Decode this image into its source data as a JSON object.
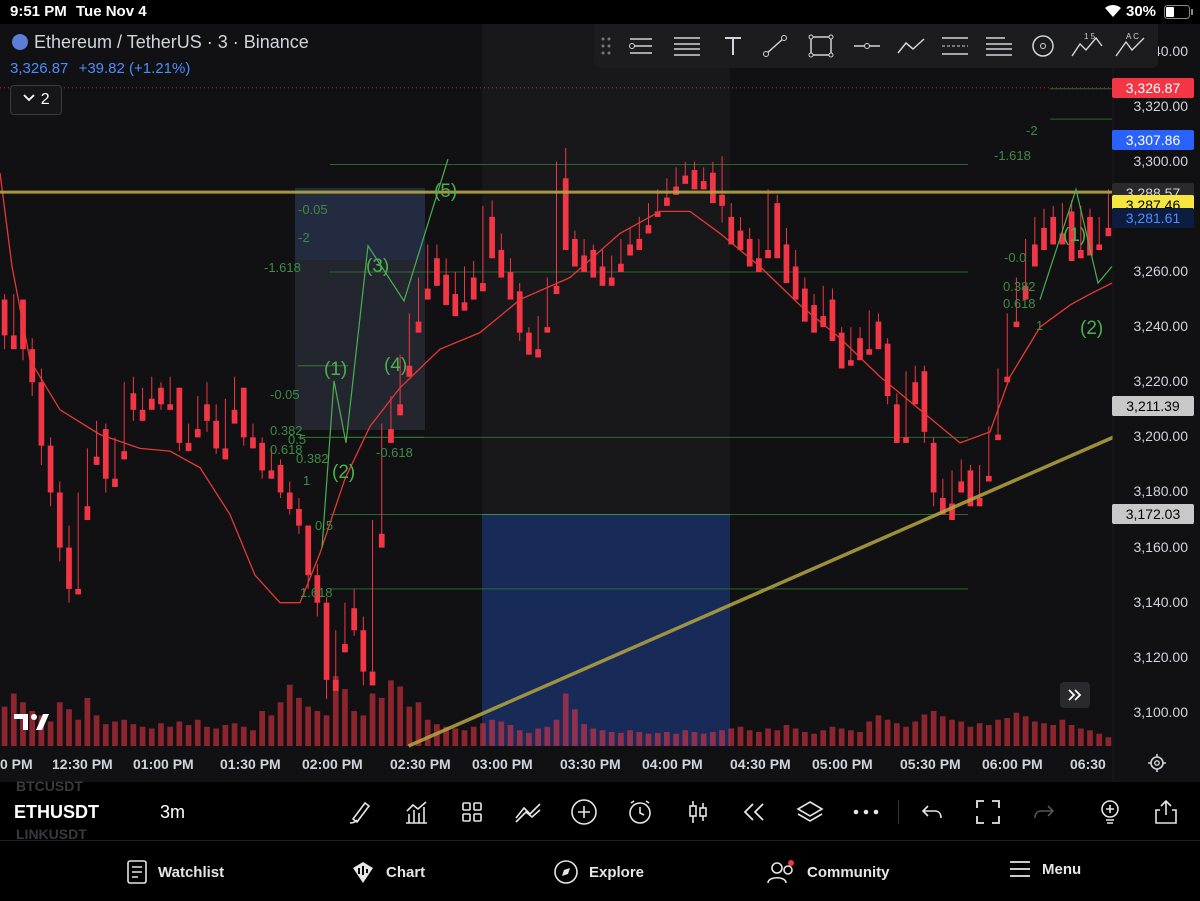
{
  "status_bar": {
    "time": "9:51 PM",
    "date": "Tue Nov 4",
    "battery": "30%"
  },
  "symbol": {
    "title": "Ethereum / TetherUS · 3 · Binance",
    "price": "3,326.87",
    "change": "+39.82 (+1.21%)",
    "indicators_count": "2"
  },
  "price_axis": {
    "ticks": [
      "3,340.00",
      "3,320.00",
      "3,300.00",
      "3,260.00",
      "3,240.00",
      "3,220.00",
      "3,200.00",
      "3,180.00",
      "3,160.00",
      "3,140.00",
      "3,120.00",
      "3,100.00"
    ],
    "tick_values": [
      3340,
      3320,
      3300,
      3260,
      3240,
      3220,
      3200,
      3180,
      3160,
      3140,
      3120,
      3100
    ],
    "flags": [
      {
        "label": "3,326.87",
        "value": 3326.87,
        "bg": "#f23645",
        "fg": "#ffffff"
      },
      {
        "label": "3,307.86",
        "value": 3307.86,
        "bg": "#2962ff",
        "fg": "#ffffff"
      },
      {
        "label": "3,288.57",
        "value": 3288.57,
        "bg": "#2a2a2a",
        "fg": "#d1d4dc"
      },
      {
        "label": "3,287.46",
        "value": 3284.3,
        "bg": "#f5e642",
        "fg": "#000000"
      },
      {
        "label": "3,281.61",
        "value": 3279.5,
        "bg": "#0d1d3f",
        "fg": "#4c8dff"
      },
      {
        "label": "3,211.39",
        "value": 3211.39,
        "bg": "#c8c8c8",
        "fg": "#000000"
      },
      {
        "label": "3,172.03",
        "value": 3172.03,
        "bg": "#c8c8c8",
        "fg": "#000000"
      }
    ]
  },
  "time_axis": {
    "ticks": [
      "0 PM",
      "12:30 PM",
      "01:00 PM",
      "01:30 PM",
      "02:00 PM",
      "02:30 PM",
      "03:00 PM",
      "03:30 PM",
      "04:00 PM",
      "04:30 PM",
      "05:00 PM",
      "05:30 PM",
      "06:00 PM",
      "06:30"
    ]
  },
  "wave_labels": [
    "(1)",
    "(2)",
    "(3)",
    "(4)",
    "(5)",
    "(1)",
    "(2)"
  ],
  "fib_labels": [
    "-0.05",
    "-2",
    "-1.618",
    "-0.05",
    "0.382",
    "0.5",
    "0.618",
    "0.382",
    "1",
    "0.5",
    "1.618",
    "-0.618",
    "-2",
    "-1.618",
    "-0.0",
    "0.382",
    "0.618",
    "1"
  ],
  "colors": {
    "up": "#2962ff",
    "down": "#f23645",
    "ma": "#e53935",
    "trendline": "#b5a642",
    "fib": "#2e7d32",
    "range_box": "#1a3a8a"
  },
  "drawing_tools": [
    "drag-handle-icon",
    "pitchfork-icon",
    "fib-retracement-icon",
    "text-icon",
    "trendline-icon",
    "rectangle-icon",
    "horizontal-ray-icon",
    "path-icon",
    "long-position-icon",
    "fib-extension-icon",
    "circle-icon",
    "elliott-impulse-icon",
    "elliott-correction-icon"
  ],
  "elliott_icon_labels": {
    "impulse": "1 5",
    "correction": "A C"
  },
  "bottom_toolbar": {
    "symbols": {
      "previous": "BTCUSDT",
      "current": "ETHUSDT",
      "next": "LINKUSDT"
    },
    "interval": "3m",
    "icons": [
      "draw-brush-icon",
      "indicators-icon",
      "layouts-icon",
      "compare-icon",
      "add-icon",
      "alert-icon",
      "candles-icon",
      "replay-icon",
      "layers-icon",
      "more-icon",
      "undo-icon",
      "fullscreen-icon",
      "redo-icon",
      "ideas-icon",
      "share-icon"
    ]
  },
  "nav": [
    {
      "label": "Watchlist",
      "icon": "watchlist-icon"
    },
    {
      "label": "Chart",
      "icon": "chart-icon"
    },
    {
      "label": "Explore",
      "icon": "compass-icon"
    },
    {
      "label": "Community",
      "icon": "community-icon"
    },
    {
      "label": "Menu",
      "icon": "menu-icon"
    }
  ],
  "chart_data": {
    "type": "candlestick",
    "symbol": "ETHUSDT",
    "interval": "3m",
    "ylim": [
      3088,
      3350
    ],
    "candles": [
      [
        3250,
        3252,
        3237,
        3232
      ],
      [
        3237,
        3252,
        3232,
        3250
      ],
      [
        3250,
        3245,
        3232,
        3228
      ],
      [
        3232,
        3236,
        3220,
        3215
      ],
      [
        3220,
        3225,
        3197,
        3190
      ],
      [
        3197,
        3200,
        3180,
        3175
      ],
      [
        3180,
        3184,
        3160,
        3155
      ],
      [
        3160,
        3168,
        3145,
        3140
      ],
      [
        3145,
        3180,
        3143,
        3175
      ],
      [
        3175,
        3196,
        3170,
        3193
      ],
      [
        3193,
        3206,
        3190,
        3203
      ],
      [
        3203,
        3205,
        3185,
        3180
      ],
      [
        3185,
        3200,
        3182,
        3195
      ],
      [
        3195,
        3220,
        3192,
        3216
      ],
      [
        3216,
        3222,
        3210,
        3206
      ],
      [
        3210,
        3218,
        3206,
        3214
      ],
      [
        3214,
        3222,
        3210,
        3218
      ],
      [
        3218,
        3220,
        3212,
        3210
      ],
      [
        3212,
        3222,
        3210,
        3218
      ],
      [
        3218,
        3212,
        3198,
        3195
      ],
      [
        3198,
        3205,
        3195,
        3203
      ],
      [
        3203,
        3215,
        3200,
        3212
      ],
      [
        3212,
        3220,
        3206,
        3202
      ],
      [
        3206,
        3212,
        3196,
        3194
      ],
      [
        3196,
        3214,
        3192,
        3210
      ],
      [
        3210,
        3222,
        3205,
        3218
      ],
      [
        3218,
        3212,
        3200,
        3197
      ],
      [
        3200,
        3205,
        3196,
        3198
      ],
      [
        3198,
        3200,
        3188,
        3185
      ],
      [
        3188,
        3196,
        3185,
        3190
      ],
      [
        3190,
        3192,
        3180,
        3178
      ],
      [
        3180,
        3184,
        3174,
        3172
      ],
      [
        3174,
        3178,
        3168,
        3165
      ],
      [
        3168,
        3165,
        3150,
        3145
      ],
      [
        3150,
        3154,
        3140,
        3135
      ],
      [
        3140,
        3142,
        3112,
        3105
      ],
      [
        3112,
        3130,
        3108,
        3125
      ],
      [
        3125,
        3140,
        3122,
        3138
      ],
      [
        3138,
        3145,
        3130,
        3128
      ],
      [
        3130,
        3135,
        3115,
        3110
      ],
      [
        3115,
        3170,
        3110,
        3165
      ],
      [
        3165,
        3205,
        3160,
        3203
      ],
      [
        3203,
        3215,
        3198,
        3212
      ],
      [
        3212,
        3230,
        3208,
        3226
      ],
      [
        3226,
        3245,
        3222,
        3242
      ],
      [
        3242,
        3258,
        3238,
        3254
      ],
      [
        3254,
        3270,
        3250,
        3265
      ],
      [
        3265,
        3270,
        3255,
        3259
      ],
      [
        3259,
        3265,
        3248,
        3252
      ],
      [
        3252,
        3260,
        3244,
        3249
      ],
      [
        3249,
        3262,
        3246,
        3258
      ],
      [
        3258,
        3264,
        3250,
        3256
      ],
      [
        3256,
        3284,
        3253,
        3280
      ],
      [
        3280,
        3286,
        3265,
        3268
      ],
      [
        3268,
        3274,
        3258,
        3260
      ],
      [
        3260,
        3265,
        3250,
        3253
      ],
      [
        3253,
        3256,
        3238,
        3235
      ],
      [
        3238,
        3240,
        3230,
        3232
      ],
      [
        3232,
        3244,
        3229,
        3240
      ],
      [
        3240,
        3258,
        3238,
        3255
      ],
      [
        3255,
        3300,
        3252,
        3294
      ],
      [
        3294,
        3305,
        3268,
        3272
      ],
      [
        3272,
        3275,
        3262,
        3266
      ],
      [
        3266,
        3272,
        3260,
        3268
      ],
      [
        3268,
        3270,
        3258,
        3262
      ],
      [
        3262,
        3268,
        3255,
        3258
      ],
      [
        3258,
        3266,
        3255,
        3263
      ],
      [
        3263,
        3272,
        3260,
        3270
      ],
      [
        3270,
        3276,
        3266,
        3272
      ],
      [
        3272,
        3280,
        3268,
        3277
      ],
      [
        3277,
        3285,
        3274,
        3282
      ],
      [
        3282,
        3290,
        3280,
        3287
      ],
      [
        3287,
        3294,
        3284,
        3291
      ],
      [
        3291,
        3298,
        3288,
        3295
      ],
      [
        3295,
        3300,
        3292,
        3297
      ],
      [
        3297,
        3300,
        3290,
        3293
      ],
      [
        3293,
        3298,
        3290,
        3296
      ],
      [
        3296,
        3300,
        3285,
        3288
      ],
      [
        3288,
        3302,
        3284,
        3278
      ],
      [
        3280,
        3285,
        3270,
        3275
      ],
      [
        3275,
        3280,
        3268,
        3272
      ],
      [
        3272,
        3276,
        3262,
        3265
      ],
      [
        3265,
        3272,
        3260,
        3268
      ],
      [
        3268,
        3290,
        3265,
        3285
      ],
      [
        3285,
        3288,
        3265,
        3270
      ],
      [
        3270,
        3276,
        3256,
        3262
      ],
      [
        3262,
        3268,
        3250,
        3254
      ],
      [
        3254,
        3258,
        3242,
        3248
      ],
      [
        3248,
        3252,
        3238,
        3244
      ],
      [
        3244,
        3255,
        3240,
        3250
      ],
      [
        3250,
        3254,
        3235,
        3238
      ],
      [
        3238,
        3240,
        3225,
        3228
      ],
      [
        3228,
        3240,
        3226,
        3236
      ],
      [
        3236,
        3240,
        3228,
        3232
      ],
      [
        3232,
        3246,
        3230,
        3242
      ],
      [
        3242,
        3245,
        3232,
        3234
      ],
      [
        3234,
        3236,
        3215,
        3212
      ],
      [
        3212,
        3216,
        3198,
        3200
      ],
      [
        3200,
        3224,
        3198,
        3220
      ],
      [
        3220,
        3226,
        3212,
        3224
      ],
      [
        3224,
        3226,
        3202,
        3198
      ],
      [
        3198,
        3200,
        3180,
        3175
      ],
      [
        3178,
        3185,
        3172,
        3176
      ],
      [
        3176,
        3188,
        3170,
        3184
      ],
      [
        3184,
        3192,
        3180,
        3188
      ],
      [
        3188,
        3190,
        3175,
        3178
      ],
      [
        3178,
        3190,
        3175,
        3186
      ],
      [
        3186,
        3204,
        3184,
        3201
      ],
      [
        3201,
        3225,
        3199,
        3222
      ],
      [
        3222,
        3245,
        3220,
        3242
      ],
      [
        3242,
        3258,
        3240,
        3255
      ],
      [
        3255,
        3272,
        3250,
        3270
      ],
      [
        3270,
        3280,
        3262,
        3276
      ],
      [
        3276,
        3283,
        3268,
        3280
      ],
      [
        3280,
        3284,
        3270,
        3274
      ],
      [
        3274,
        3285,
        3270,
        3282
      ],
      [
        3282,
        3286,
        3264,
        3268
      ],
      [
        3268,
        3284,
        3265,
        3280
      ],
      [
        3280,
        3283,
        3266,
        3270
      ],
      [
        3270,
        3280,
        3268,
        3276
      ],
      [
        3276,
        3290,
        3273,
        3285
      ]
    ],
    "moving_average": [
      [
        0,
        3296
      ],
      [
        12,
        3262
      ],
      [
        30,
        3228
      ],
      [
        60,
        3210
      ],
      [
        100,
        3201
      ],
      [
        140,
        3196
      ],
      [
        170,
        3195
      ],
      [
        200,
        3189
      ],
      [
        230,
        3172
      ],
      [
        255,
        3150
      ],
      [
        280,
        3140
      ],
      [
        300,
        3140
      ],
      [
        320,
        3158
      ],
      [
        345,
        3185
      ],
      [
        370,
        3204
      ],
      [
        400,
        3218
      ],
      [
        440,
        3232
      ],
      [
        480,
        3238
      ],
      [
        520,
        3250
      ],
      [
        570,
        3258
      ],
      [
        620,
        3274
      ],
      [
        660,
        3282
      ],
      [
        690,
        3282
      ],
      [
        720,
        3274
      ],
      [
        760,
        3262
      ],
      [
        800,
        3248
      ],
      [
        840,
        3236
      ],
      [
        880,
        3222
      ],
      [
        920,
        3210
      ],
      [
        960,
        3198
      ],
      [
        990,
        3202
      ],
      [
        1010,
        3222
      ],
      [
        1040,
        3240
      ],
      [
        1070,
        3248
      ],
      [
        1090,
        3252
      ],
      [
        1112,
        3256
      ]
    ],
    "volume": [
      45,
      60,
      50,
      40,
      35,
      28,
      50,
      42,
      30,
      55,
      35,
      25,
      28,
      30,
      25,
      22,
      20,
      26,
      22,
      28,
      24,
      30,
      22,
      20,
      24,
      26,
      22,
      18,
      40,
      35,
      50,
      70,
      55,
      45,
      40,
      35,
      80,
      65,
      40,
      35,
      60,
      55,
      75,
      68,
      45,
      50,
      30,
      25,
      22,
      20,
      18,
      22,
      26,
      30,
      28,
      24,
      18,
      15,
      20,
      22,
      30,
      60,
      42,
      25,
      20,
      18,
      16,
      15,
      18,
      16,
      14,
      15,
      16,
      14,
      18,
      16,
      14,
      16,
      18,
      20,
      22,
      18,
      16,
      20,
      18,
      24,
      20,
      16,
      14,
      18,
      22,
      20,
      18,
      16,
      28,
      35,
      30,
      26,
      22,
      28,
      36,
      40,
      34,
      30,
      28,
      22,
      26,
      24,
      30,
      32,
      38,
      34,
      28,
      26,
      24,
      30,
      24,
      20,
      18,
      14
    ],
    "horizontal_line": 3289,
    "trendline": {
      "x1": 0.345,
      "y1": 3088,
      "x2": 1,
      "y2": 3200
    },
    "fib_levels": [
      3326.5,
      3315.5,
      3299,
      3260,
      3200,
      3172,
      3145
    ],
    "shaded_zone": [
      3172,
      3088
    ],
    "wave_points": [
      [
        3215,
        3226
      ],
      [
        3194,
        3202
      ],
      [
        3262,
        3277
      ],
      [
        3245,
        3254
      ],
      [
        3300,
        3302
      ],
      [
        3280,
        3290
      ],
      [
        3256,
        3246
      ]
    ]
  }
}
